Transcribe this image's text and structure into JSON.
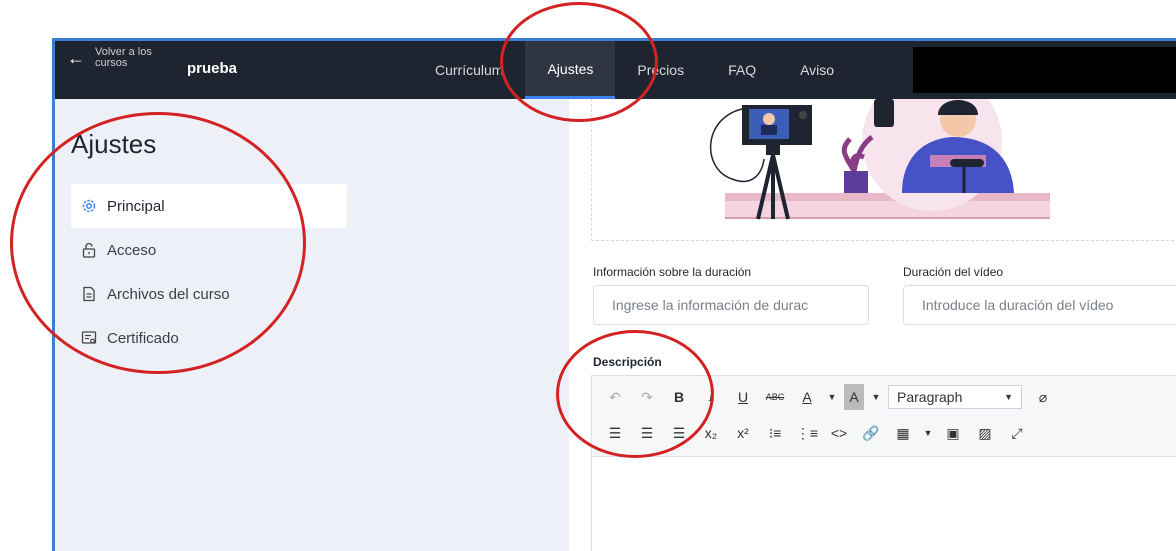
{
  "header": {
    "back_label": "Volver a los cursos",
    "course_name": "prueba",
    "tabs": [
      {
        "label": "Currículum"
      },
      {
        "label": "Ajustes"
      },
      {
        "label": "Precios"
      },
      {
        "label": "FAQ"
      },
      {
        "label": "Aviso"
      }
    ],
    "active_tab": "Ajustes"
  },
  "sidebar": {
    "title": "Ajustes",
    "items": [
      {
        "label": "Principal",
        "icon": "gear-icon"
      },
      {
        "label": "Acceso",
        "icon": "lock-icon"
      },
      {
        "label": "Archivos del curso",
        "icon": "file-icon"
      },
      {
        "label": "Certificado",
        "icon": "certificate-icon"
      }
    ],
    "active_item": "Principal"
  },
  "main": {
    "duration_info": {
      "label": "Información sobre la duración",
      "placeholder": "Ingrese la información de durac"
    },
    "video_duration": {
      "label": "Duración del vídeo",
      "placeholder": "Introduce la duración del vídeo"
    },
    "description": {
      "label": "Descripción",
      "format_select": "Paragraph"
    }
  },
  "colors": {
    "topbar": "#1f2530",
    "accent": "#3b82f6",
    "annotation": "#d42222"
  }
}
